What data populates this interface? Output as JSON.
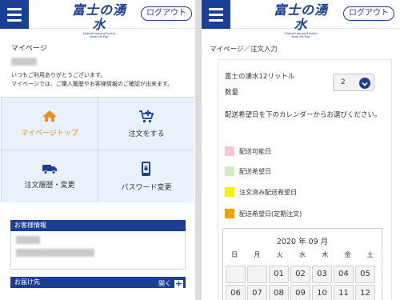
{
  "left": {
    "header": {
      "logo_text": "富士の湧水",
      "logo_sub1": "Natural mineral water",
      "logo_sub2": "from Mt.Fuji",
      "logout_label": "ログアウト"
    },
    "page_title": "マイページ",
    "welcome_line1": "いつもご利用ありがとうございます。",
    "welcome_line2": "マイページでは、ご購入履歴やお客様情報のご確認が出来ます。",
    "tiles": [
      {
        "label": "マイページトップ",
        "icon": "home-icon",
        "active": true
      },
      {
        "label": "注文をする",
        "icon": "cart-icon",
        "active": false
      },
      {
        "label": "注文履歴・変更",
        "icon": "truck-icon",
        "active": false
      },
      {
        "label": "パスワード変更",
        "icon": "phone-lock-icon",
        "active": false
      }
    ],
    "customer_info_title": "お客様情報",
    "delivery_title": "お届け先",
    "delivery_open_label": "開く",
    "colors": {
      "primary": "#1b3f95",
      "active": "#f08c1e",
      "tile_bg": "#e9f2fa"
    }
  },
  "right": {
    "header": {
      "logo_text": "富士の湧水",
      "logo_sub1": "Natural mineral water",
      "logo_sub2": "from Mt.Fuji",
      "logout_label": "ログアウト"
    },
    "breadcrumb": "マイページ／注文入力",
    "product_name": "富士の湧水12リットル",
    "qty_label": "数量",
    "qty_value": "2",
    "note": "配送希望日を下のカレンダーからお選びください。",
    "legend": [
      {
        "label": "配送可能日",
        "color": "#f9c6d3"
      },
      {
        "label": "配送希望日",
        "color": "#cdedc4"
      },
      {
        "label": "注文済み配送希望日",
        "color": "#f5f000"
      },
      {
        "label": "配送希望日(定期注文)",
        "color": "#f4a000"
      }
    ],
    "calendar": {
      "title": "2020 年 09 月",
      "weekdays": [
        "日",
        "月",
        "火",
        "水",
        "木",
        "金",
        "土"
      ],
      "days": [
        "",
        "",
        "01",
        "02",
        "03",
        "04",
        "05",
        "06",
        "07",
        "08",
        "09",
        "10",
        "11",
        "12"
      ]
    }
  }
}
